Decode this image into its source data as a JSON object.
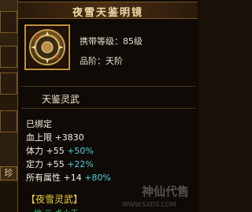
{
  "background": {
    "tab_label": "珍"
  },
  "tooltip": {
    "title": "夜雪天鉴明镜",
    "carry_level": "携带等级：85级",
    "grade": "品阶：天阶",
    "item_name": "天鉴灵武",
    "bound_status": "已绑定",
    "icon": "shield-medallion-icon",
    "stats": [
      {
        "label": "血上限",
        "value": "+3830",
        "bonus": ""
      },
      {
        "label": "体力",
        "value": "+55",
        "bonus": "+50%"
      },
      {
        "label": "定力",
        "value": "+55",
        "bonus": "+22%"
      },
      {
        "label": "所有属性",
        "value": "+14",
        "bonus": "+80%"
      }
    ],
    "set_name": "【夜雪灵武】",
    "set_line_partial": "  ▪ 地·二·点小天"
  },
  "watermark": {
    "text": "神仙代售",
    "url": "WWW.SXDS.COM"
  },
  "colors": {
    "title": "#f0dca8",
    "bonus": "#4fd0e0",
    "set_name": "#f0d040",
    "border": "#c09040"
  }
}
